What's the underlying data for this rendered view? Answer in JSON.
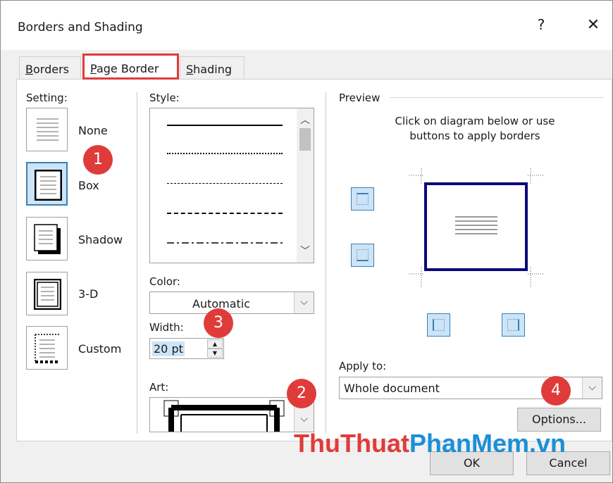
{
  "window": {
    "title": "Borders and Shading",
    "help_glyph": "?",
    "close_glyph": "✕"
  },
  "tabs": [
    {
      "label_u": "B",
      "label_rest": "orders"
    },
    {
      "label_u": "P",
      "label_rest": "age Border",
      "selected": true
    },
    {
      "label_u": "S",
      "label_rest": "hading"
    }
  ],
  "setting": {
    "label": "Setting:",
    "options": [
      {
        "label": "None"
      },
      {
        "label": "Box",
        "selected": true
      },
      {
        "label": "Shadow"
      },
      {
        "label": "3-D"
      },
      {
        "label": "Custom"
      }
    ]
  },
  "style": {
    "label": "Style:"
  },
  "color": {
    "label": "Color:",
    "value": "Automatic"
  },
  "width": {
    "label": "Width:",
    "value": "20 pt"
  },
  "art": {
    "label": "Art:"
  },
  "preview": {
    "label": "Preview",
    "hint": "Click on diagram below or use buttons to apply borders"
  },
  "apply_to": {
    "label": "Apply to:",
    "value": "Whole document"
  },
  "buttons": {
    "options": "Options...",
    "ok": "OK",
    "cancel": "Cancel"
  },
  "badges": [
    "1",
    "2",
    "3",
    "4"
  ],
  "watermark": {
    "part1": "ThuThuat",
    "part2": "PhanMem.vn"
  },
  "colors": {
    "accent_red": "#e03b3b",
    "selection_blue": "#cce4f7",
    "border_blue": "#0a0a7a"
  }
}
